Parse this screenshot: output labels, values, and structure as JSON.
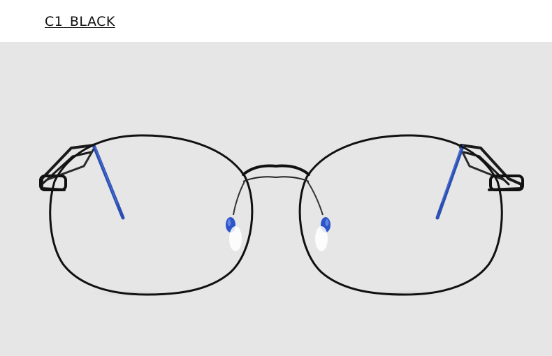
{
  "header": {
    "variant_label": "C1  BLACK"
  },
  "product_photo": {
    "subject": "round-metal-eyeglasses",
    "frame_color": "#111111",
    "temple_tip_color": "#2b4fb3",
    "nose_pad_color": "#2d55c9",
    "background_color": "#e6e6e6"
  }
}
